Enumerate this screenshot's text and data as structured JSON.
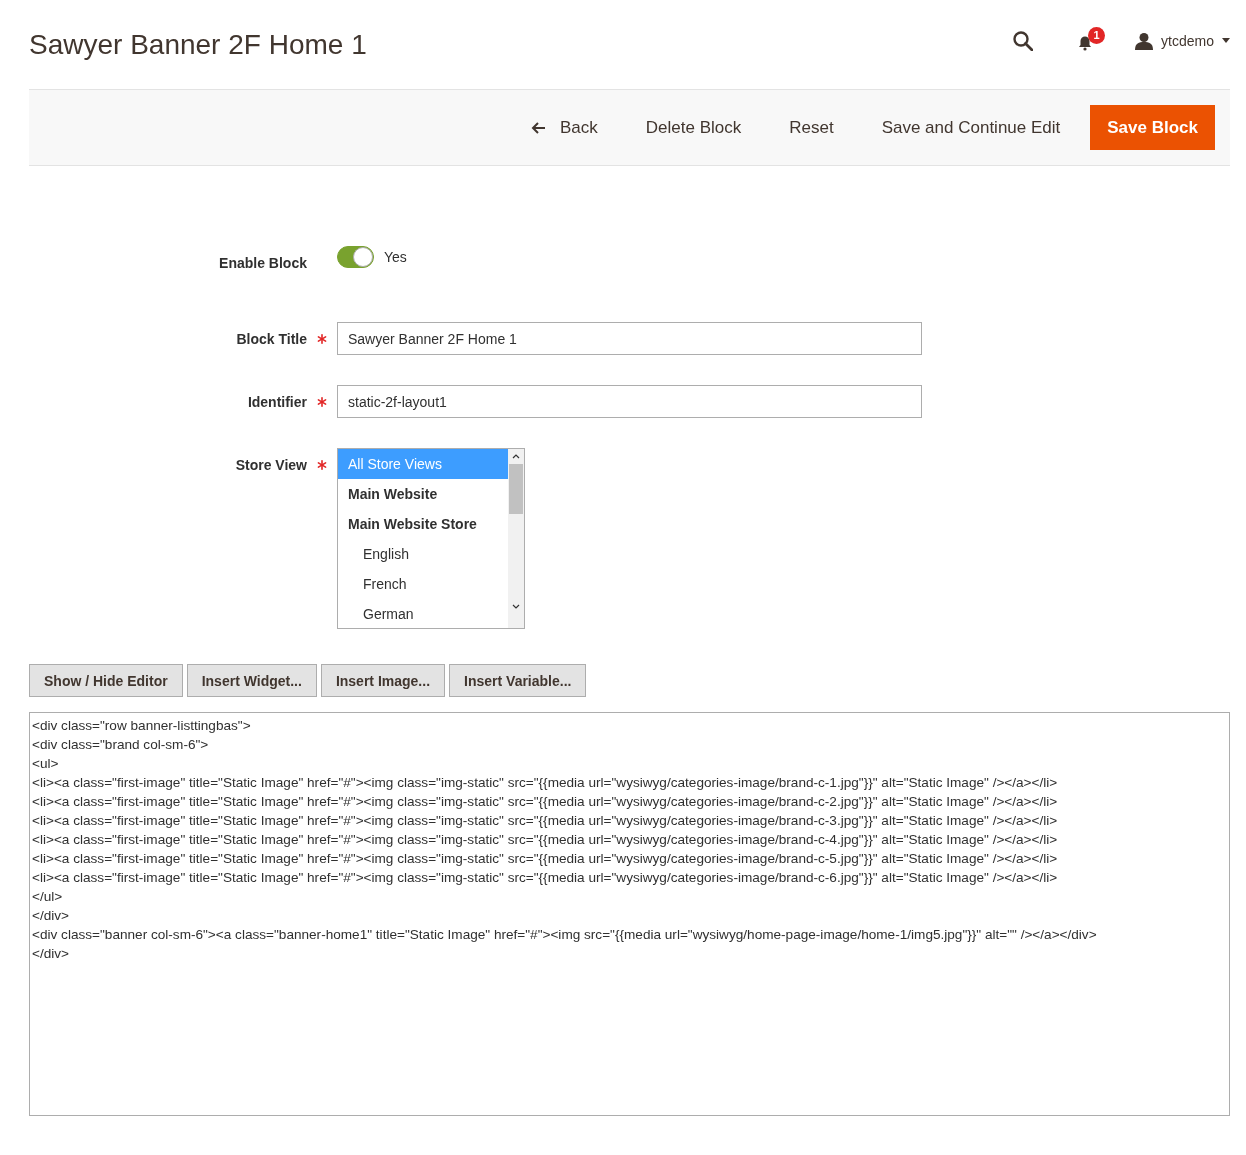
{
  "page_title": "Sawyer Banner 2F Home 1",
  "header": {
    "notifications_count": "1",
    "user_name": "ytcdemo"
  },
  "actions": [
    {
      "label": "Back",
      "kind": "back"
    },
    {
      "label": "Delete Block",
      "kind": "plain"
    },
    {
      "label": "Reset",
      "kind": "plain"
    },
    {
      "label": "Save and Continue Edit",
      "kind": "plain"
    },
    {
      "label": "Save Block",
      "kind": "primary"
    }
  ],
  "form": {
    "enable_block": {
      "label": "Enable Block",
      "on": true,
      "value_label": "Yes",
      "required": false
    },
    "block_title": {
      "label": "Block Title",
      "required": true,
      "value": "Sawyer Banner 2F Home 1"
    },
    "identifier": {
      "label": "Identifier",
      "required": true,
      "value": "static-2f-layout1"
    },
    "store_view": {
      "label": "Store View",
      "required": true,
      "options": [
        {
          "label": "All Store Views",
          "selected": true
        },
        {
          "label": "Main Website",
          "selected": false,
          "children": [
            {
              "label": "Main Website Store",
              "selected": false,
              "children": [
                {
                  "label": "English",
                  "selected": false
                },
                {
                  "label": "French",
                  "selected": false
                },
                {
                  "label": "German",
                  "selected": false
                }
              ]
            }
          ]
        }
      ]
    }
  },
  "editor_buttons": [
    "Show / Hide Editor",
    "Insert Widget...",
    "Insert Image...",
    "Insert Variable..."
  ],
  "editor": {
    "value": [
      "<div class=\"row banner-listtingbas\">",
      "<div class=\"brand col-sm-6\">",
      "<ul>",
      "<li><a class=\"first-image\" title=\"Static Image\" href=\"#\"><img class=\"img-static\" src=\"{{media url=\"wysiwyg/categories-image/brand-c-1.jpg\"}}\" alt=\"Static Image\" /></a></li>",
      "<li><a class=\"first-image\" title=\"Static Image\" href=\"#\"><img class=\"img-static\" src=\"{{media url=\"wysiwyg/categories-image/brand-c-2.jpg\"}}\" alt=\"Static Image\" /></a></li>",
      "<li><a class=\"first-image\" title=\"Static Image\" href=\"#\"><img class=\"img-static\" src=\"{{media url=\"wysiwyg/categories-image/brand-c-3.jpg\"}}\" alt=\"Static Image\" /></a></li>",
      "<li><a class=\"first-image\" title=\"Static Image\" href=\"#\"><img class=\"img-static\" src=\"{{media url=\"wysiwyg/categories-image/brand-c-4.jpg\"}}\" alt=\"Static Image\" /></a></li>",
      "<li><a class=\"first-image\" title=\"Static Image\" href=\"#\"><img class=\"img-static\" src=\"{{media url=\"wysiwyg/categories-image/brand-c-5.jpg\"}}\" alt=\"Static Image\" /></a></li>",
      "<li><a class=\"first-image\" title=\"Static Image\" href=\"#\"><img class=\"img-static\" src=\"{{media url=\"wysiwyg/categories-image/brand-c-6.jpg\"}}\" alt=\"Static Image\" /></a></li>",
      "</ul>",
      "</div>",
      "<div class=\"banner col-sm-6\"><a class=\"banner-home1\" title=\"Static Image\" href=\"#\"><img src=\"{{media url=\"wysiwyg/home-page-image/home-1/img5.jpg\"}}\" alt=\"\" /></a></div>",
      "</div>"
    ]
  }
}
